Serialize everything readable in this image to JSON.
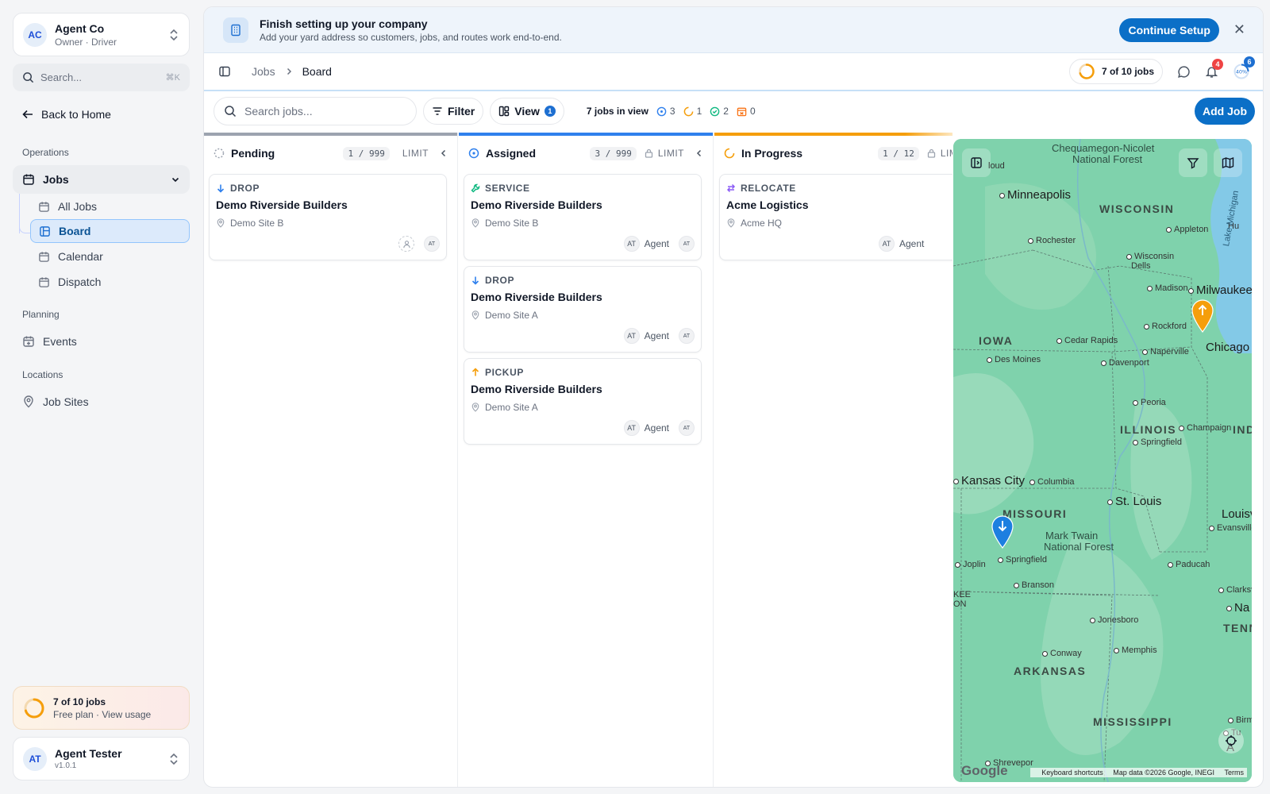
{
  "company": {
    "initials": "AC",
    "name": "Agent Co",
    "role": "Owner · Driver"
  },
  "sidebar": {
    "search_placeholder": "Search...",
    "search_shortcut": "⌘K",
    "back_label": "Back to Home",
    "sections": {
      "operations": "Operations",
      "planning": "Planning",
      "locations": "Locations"
    },
    "jobs_label": "Jobs",
    "jobs_sub": [
      "All Jobs",
      "Board",
      "Calendar",
      "Dispatch"
    ],
    "events_label": "Events",
    "jobsites_label": "Job Sites",
    "usage": {
      "title": "7 of 10 jobs",
      "sub": "Free plan · View usage",
      "progress": 0.7
    },
    "user": {
      "initials": "AT",
      "name": "Agent Tester",
      "version": "v1.0.1"
    }
  },
  "banner": {
    "title": "Finish setting up your company",
    "subtitle": "Add your yard address so customers, jobs, and routes work end-to-end.",
    "button": "Continue Setup",
    "close": "✕"
  },
  "topbar": {
    "crumb_parent": "Jobs",
    "crumb_current": "Board",
    "jobs_pill": "7 of 10 jobs",
    "notification_count": "4",
    "progress_count": "6",
    "progress_text": "40%"
  },
  "toolbar": {
    "search_placeholder": "Search jobs...",
    "filter_label": "Filter",
    "view_label": "View",
    "view_count": "1",
    "in_view": "7 jobs in view",
    "count_assigned": "3",
    "count_in_progress": "1",
    "count_done": "2",
    "count_cancelled": "0",
    "add_job": "Add Job"
  },
  "columns": {
    "pending": {
      "title": "Pending",
      "count": "1 / 999",
      "limit": "LIMIT",
      "color": "#9ca3af",
      "cards": [
        {
          "type": "DROP",
          "title": "Demo Riverside Builders",
          "site": "Demo Site B"
        }
      ]
    },
    "assigned": {
      "title": "Assigned",
      "count": "3 / 999",
      "limit": "LIMIT",
      "color": "#2f80ed",
      "cards": [
        {
          "type": "SERVICE",
          "title": "Demo Riverside Builders",
          "site": "Demo Site B",
          "agent": "Agent",
          "initials": "AT"
        },
        {
          "type": "DROP",
          "title": "Demo Riverside Builders",
          "site": "Demo Site A",
          "agent": "Agent",
          "initials": "AT"
        },
        {
          "type": "PICKUP",
          "title": "Demo Riverside Builders",
          "site": "Demo Site A",
          "agent": "Agent",
          "initials": "AT"
        }
      ]
    },
    "in_progress": {
      "title": "In Progress",
      "count": "1 / 12",
      "limit": "LIMIT",
      "color": "#f59e0b",
      "cards": [
        {
          "type": "RELOCATE",
          "title": "Acme Logistics",
          "site": "Acme HQ",
          "agent": "Agent",
          "initials": "AT"
        }
      ]
    }
  },
  "map": {
    "labels": {
      "forest1": "Chequamegon-Nicolet",
      "forest1b": "National Forest",
      "minneapolis": "Minneapolis",
      "wisconsin": "WISCONSIN",
      "appleton": "Appleton",
      "rochester": "Rochester",
      "wisdells": "Wisconsin",
      "wisdells2": "Dells",
      "madison": "Madison",
      "milwaukee": "Milwaukee",
      "rockford": "Rockford",
      "chicago": "Chicago",
      "iowa": "IOWA",
      "cedarrapids": "Cedar Rapids",
      "naperville": "Naperville",
      "desmoines": "Des Moines",
      "davenport": "Davenport",
      "peoria": "Peoria",
      "illinois": "ILLINOIS",
      "champaign": "Champaign",
      "springfield_il": "Springfield",
      "kansascity": "Kansas City",
      "columbia": "Columbia",
      "stlouis": "St. Louis",
      "missouri": "MISSOURI",
      "louisville": "Louisv",
      "evansville": "Evansville",
      "marktwain": "Mark Twain",
      "marktwain2": "National Forest",
      "joplin": "Joplin",
      "springfield_mo": "Springfield",
      "paducah": "Paducah",
      "branson": "Branson",
      "clarksville": "Clarksvill",
      "na": "Na",
      "tennessee": "TENNES",
      "jonesboro": "Jonesboro",
      "memphis": "Memphis",
      "conway": "Conway",
      "arkansas": "ARKANSAS",
      "mississippi": "MISSISSIPPI",
      "lakemichigan": "Lake Michigan",
      "cloud": "loud",
      "ind": "IND",
      "hu": "Hu",
      "na2": "Na",
      "kee": "KEE",
      "on": "ON",
      "shreveport": "Shrevepor",
      "birm": "Birm",
      "tu": "Tu",
      "a": "A"
    },
    "google": "Google",
    "attribution": {
      "shortcuts": "Keyboard shortcuts",
      "data": "Map data ©2026 Google, INEGI",
      "terms": "Terms"
    }
  },
  "colors": {
    "accent": "#0b6fc7",
    "pending": "#9ca3af",
    "assigned": "#2f80ed",
    "in_progress": "#f59e0b",
    "done": "#10b981",
    "cancelled": "#f97316",
    "map_land": "#7fd2ac",
    "map_water": "#83c9e7"
  }
}
